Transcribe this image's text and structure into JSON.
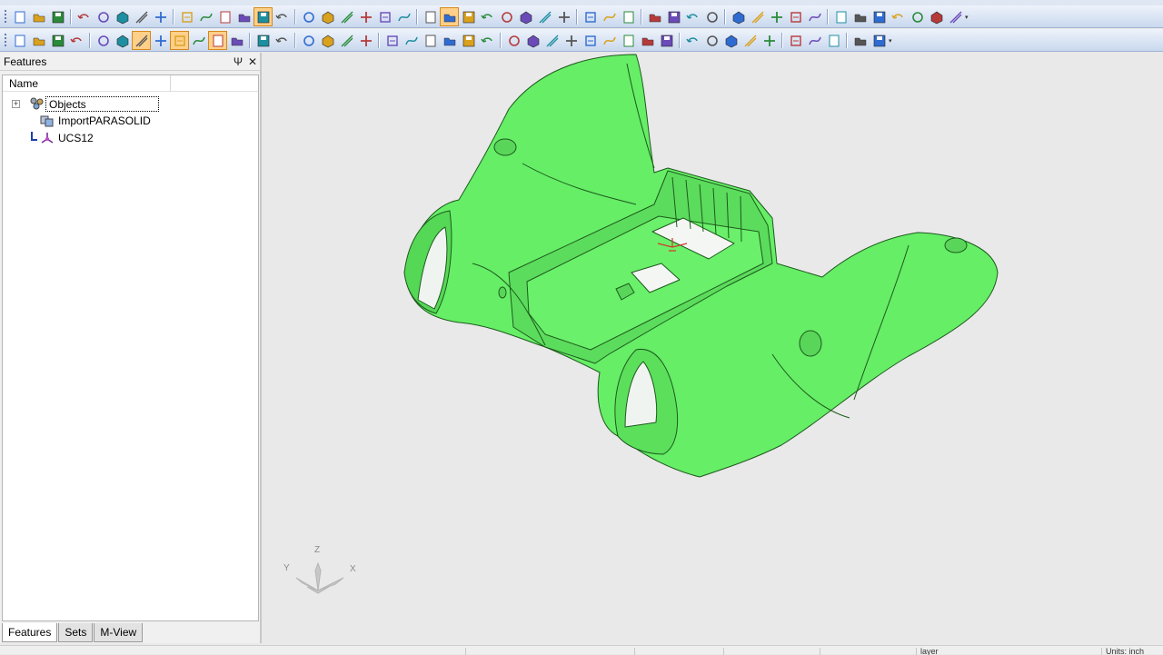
{
  "toolbar_row_1": {
    "icons": [
      "new-file-icon",
      "open-folder-icon",
      "save-icon",
      "undo-icon",
      "redo-icon",
      "link-icon",
      "transform-icon",
      "array-icon",
      "zoom-fit-icon",
      "zoom-window-icon",
      "zoom-previous-icon",
      "zoom-icon",
      "pan-icon",
      "rotate-view-icon",
      "view-iso-icon",
      "view-front-icon",
      "view-top-icon",
      "view-right-icon",
      "view-back-icon",
      "view-left-icon",
      "named-views-icon",
      "render-mode-icon",
      "shaded-edges-icon",
      "wireframe-icon",
      "hidden-lines-icon",
      "display-style-icon",
      "light-icon",
      "bulb-icon",
      "measure-icon",
      "prev-icon",
      "next-icon",
      "snap-icon",
      "dimension-icon",
      "layer-icon",
      "attributes-icon",
      "grid-icon",
      "color-icon",
      "pen-icon",
      "hatch-icon",
      "line-weight-icon",
      "sketch-line-icon",
      "sketch-polyline-icon",
      "sketch-circle-icon",
      "sketch-arc-icon",
      "sketch-spline-icon",
      "sketch-trim-icon",
      "sketch-delete-icon"
    ]
  },
  "toolbar_row_2": {
    "icons": [
      "select-icon",
      "delete-icon",
      "select-filter-icon",
      "paint-select-icon",
      "group-icon",
      "highlight-icon",
      "edit-icon",
      "edge-select-icon",
      "face-select-icon",
      "body-select-icon",
      "text-select-icon",
      "attribute-select-icon",
      "split-icon",
      "align-icon",
      "point-icon",
      "line-icon",
      "wave-icon",
      "circle-icon",
      "curve-icon",
      "offset-curve-icon",
      "project-curve-icon",
      "extend-icon",
      "intersect-icon",
      "extrude-icon",
      "revolve-icon",
      "sweep-icon",
      "loft-icon",
      "surface-icon",
      "blend-icon",
      "boundary-icon",
      "fillet-surface-icon",
      "patch-icon",
      "shell-icon",
      "solid-icon",
      "draft-icon",
      "mirror-icon",
      "pattern-icon",
      "boolean-icon",
      "split-body-icon",
      "check-icon",
      "analysis-icon",
      "settings-icon",
      "end-icon"
    ]
  },
  "panel": {
    "title": "Features",
    "pin": "Ψ",
    "close": "✕",
    "column_name": "Name",
    "tree": [
      {
        "label": "Objects",
        "icon": "objects-icon",
        "expander": "+"
      },
      {
        "label": "ImportPARASOLID",
        "icon": "import-icon"
      },
      {
        "label": "UCS12",
        "icon": "ucs-icon"
      }
    ],
    "tabs": [
      "Features",
      "Sets",
      "M-View"
    ],
    "active_tab": "Features"
  },
  "viewport": {
    "model_color": "#66ee66",
    "axis_labels": {
      "z": "Z",
      "y": "Y",
      "x": "X"
    }
  },
  "statusbar": {
    "units_label": "Units: inch",
    "layer_label": "layer"
  },
  "colors": {
    "toolbar_top": "#eef3fb",
    "toolbar_bottom": "#c9d8ee",
    "viewport_bg": "#e9e9e9",
    "model_edge": "#1d5a1d",
    "selected_tool": "#ffd089"
  }
}
